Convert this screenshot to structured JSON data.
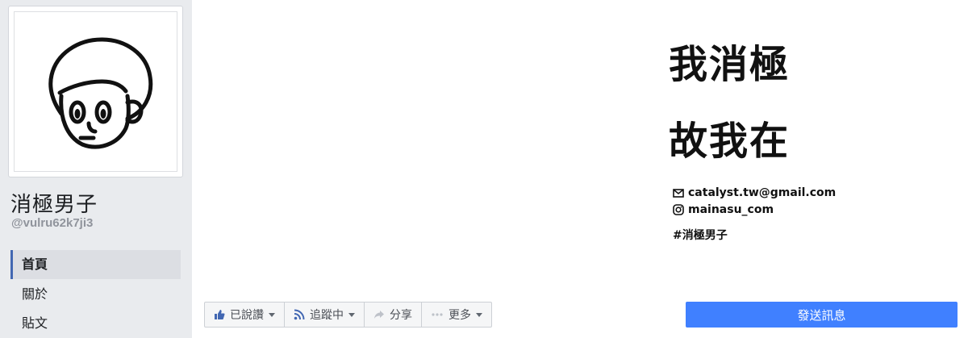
{
  "sidebar": {
    "page_name": "消極男子",
    "handle": "@vulru62k7ji3",
    "nav": [
      {
        "label": "首頁",
        "active": true
      },
      {
        "label": "關於",
        "active": false
      },
      {
        "label": "貼文",
        "active": false
      }
    ]
  },
  "cover": {
    "slogan_line1": "我消極",
    "slogan_line2": "故我在",
    "email": "catalyst.tw@gmail.com",
    "instagram": "mainasu_com",
    "hashtag": "#消極男子"
  },
  "actions": {
    "like_label": "已說讚",
    "follow_label": "追蹤中",
    "share_label": "分享",
    "more_label": "更多"
  },
  "send_message_label": "發送訊息",
  "colors": {
    "accent": "#4267b2",
    "send_button": "#4080ff",
    "sidebar_bg": "#e9ebee"
  }
}
